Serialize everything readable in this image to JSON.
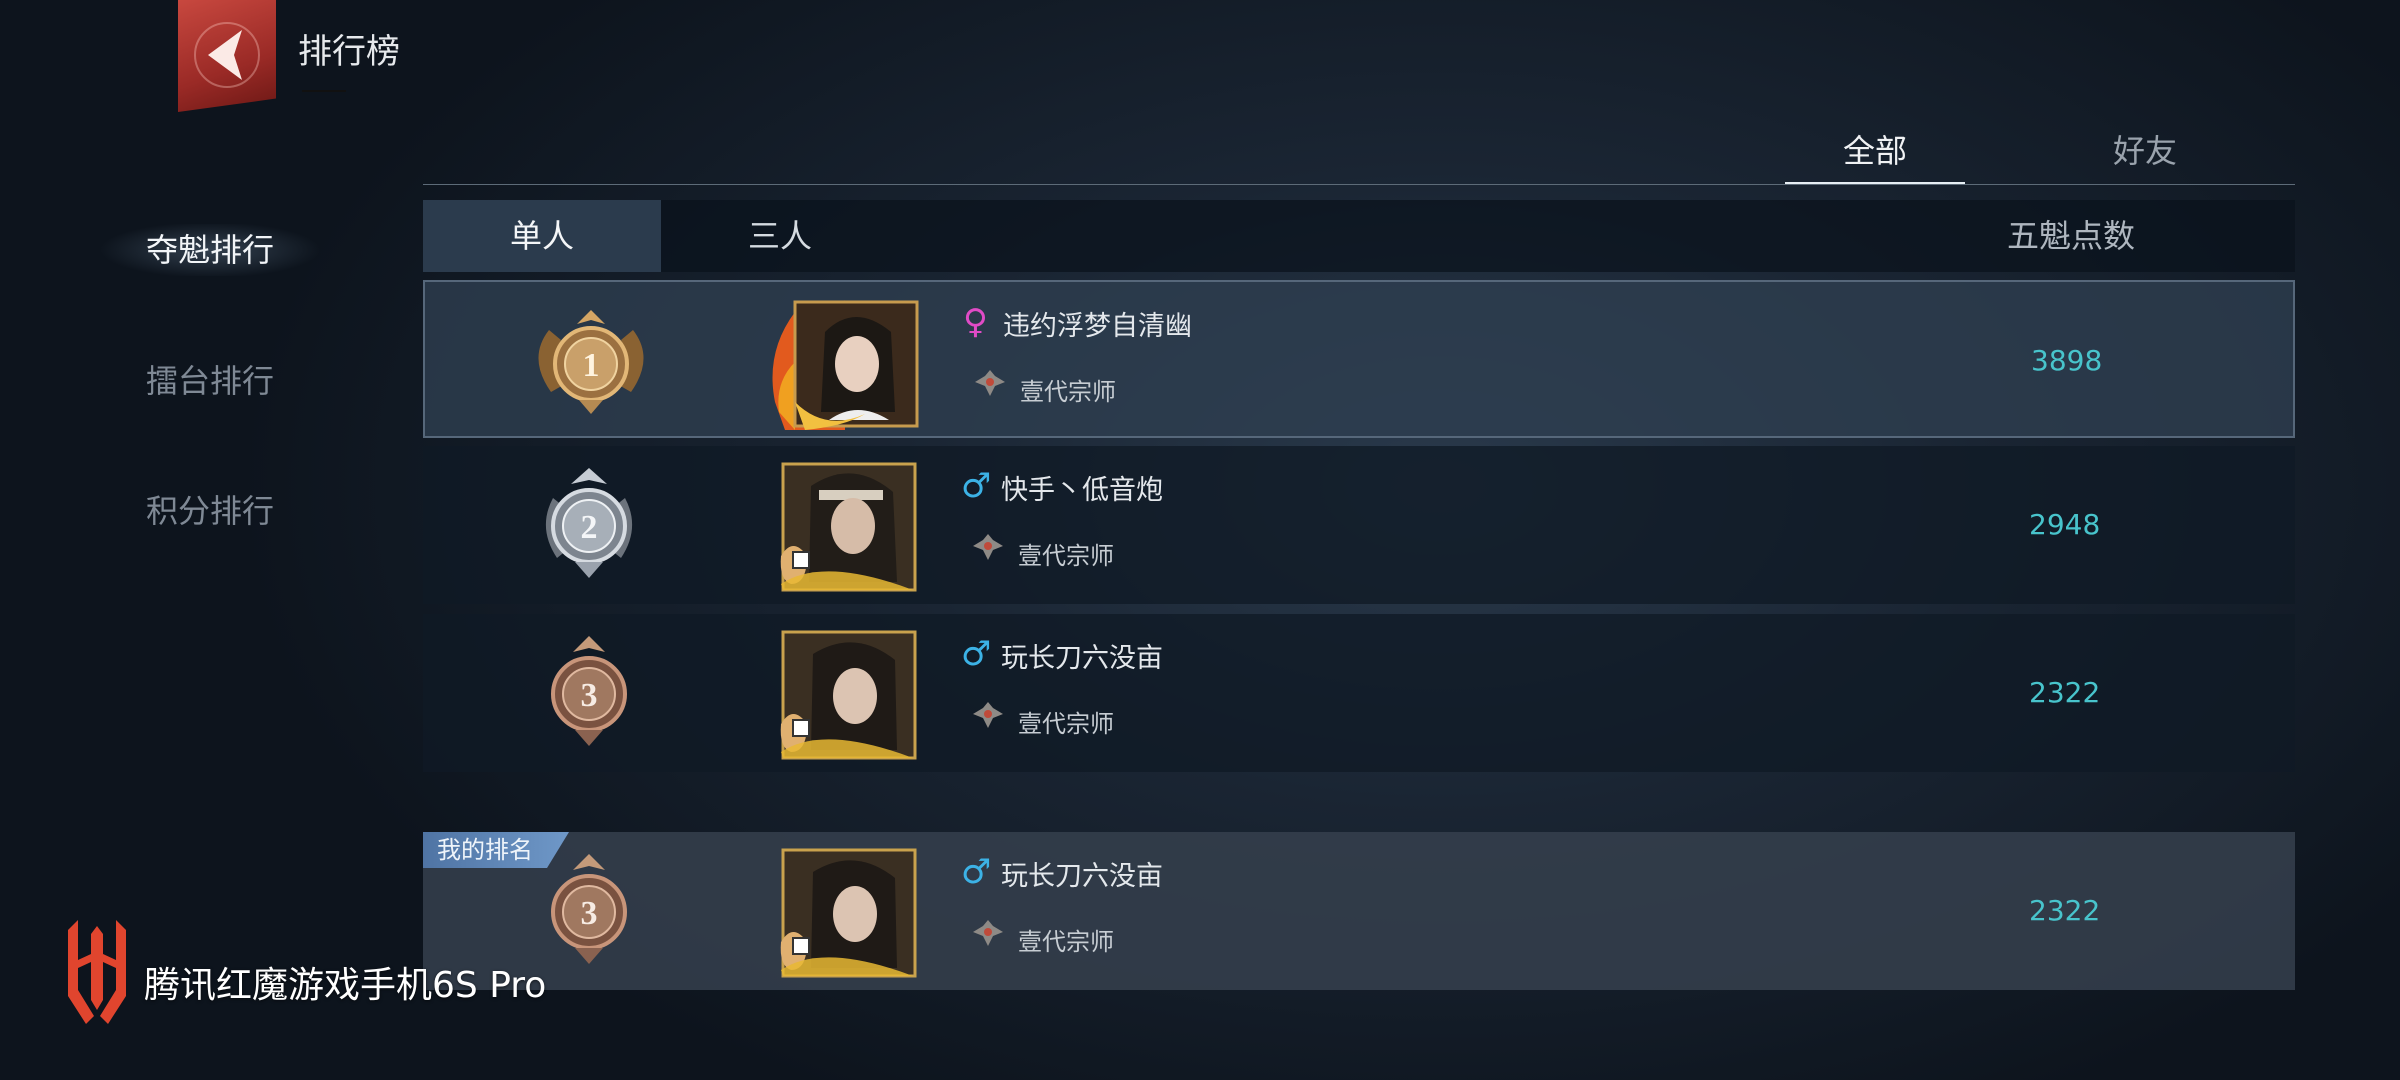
{
  "header": {
    "title": "排行榜"
  },
  "filter_tabs": [
    {
      "label": "全部",
      "active": true
    },
    {
      "label": "好友",
      "active": false
    }
  ],
  "sidebar": {
    "items": [
      {
        "label": "夺魁排行",
        "active": true
      },
      {
        "label": "擂台排行",
        "active": false
      },
      {
        "label": "积分排行",
        "active": false
      }
    ]
  },
  "table": {
    "mode_tabs": [
      {
        "label": "单人",
        "active": true
      },
      {
        "label": "三人",
        "active": false
      }
    ],
    "points_header": "五魁点数",
    "rows": [
      {
        "rank": 1,
        "gender": "female",
        "gender_glyph": "♀",
        "name": "违约浮梦自清幽",
        "title": "壹代宗师",
        "points": "3898"
      },
      {
        "rank": 2,
        "gender": "male",
        "gender_glyph": "♂",
        "name": "快手丶低音炮",
        "title": "壹代宗师",
        "points": "2948"
      },
      {
        "rank": 3,
        "gender": "male",
        "gender_glyph": "♂",
        "name": "玩长刀六没亩",
        "title": "壹代宗师",
        "points": "2322"
      }
    ]
  },
  "my_rank": {
    "tag": "我的排名",
    "rank": 3,
    "gender": "male",
    "gender_glyph": "♂",
    "name": "玩长刀六没亩",
    "title": "壹代宗师",
    "points": "2322"
  },
  "watermark": {
    "text": "腾讯红魔游戏手机6S Pro"
  },
  "colors": {
    "points": "#48c4cc",
    "female": "#e04bc6",
    "male": "#3cb2e6",
    "gold_medal": "#b98a4e",
    "silver_medal": "#9aa2ad",
    "bronze_medal": "#9a6d55",
    "brand_red": "#e0452e"
  },
  "icons": {
    "back": "back-arrow-icon",
    "title_badge": "rank-title-icon",
    "medal": "laurel-medal-icon"
  }
}
